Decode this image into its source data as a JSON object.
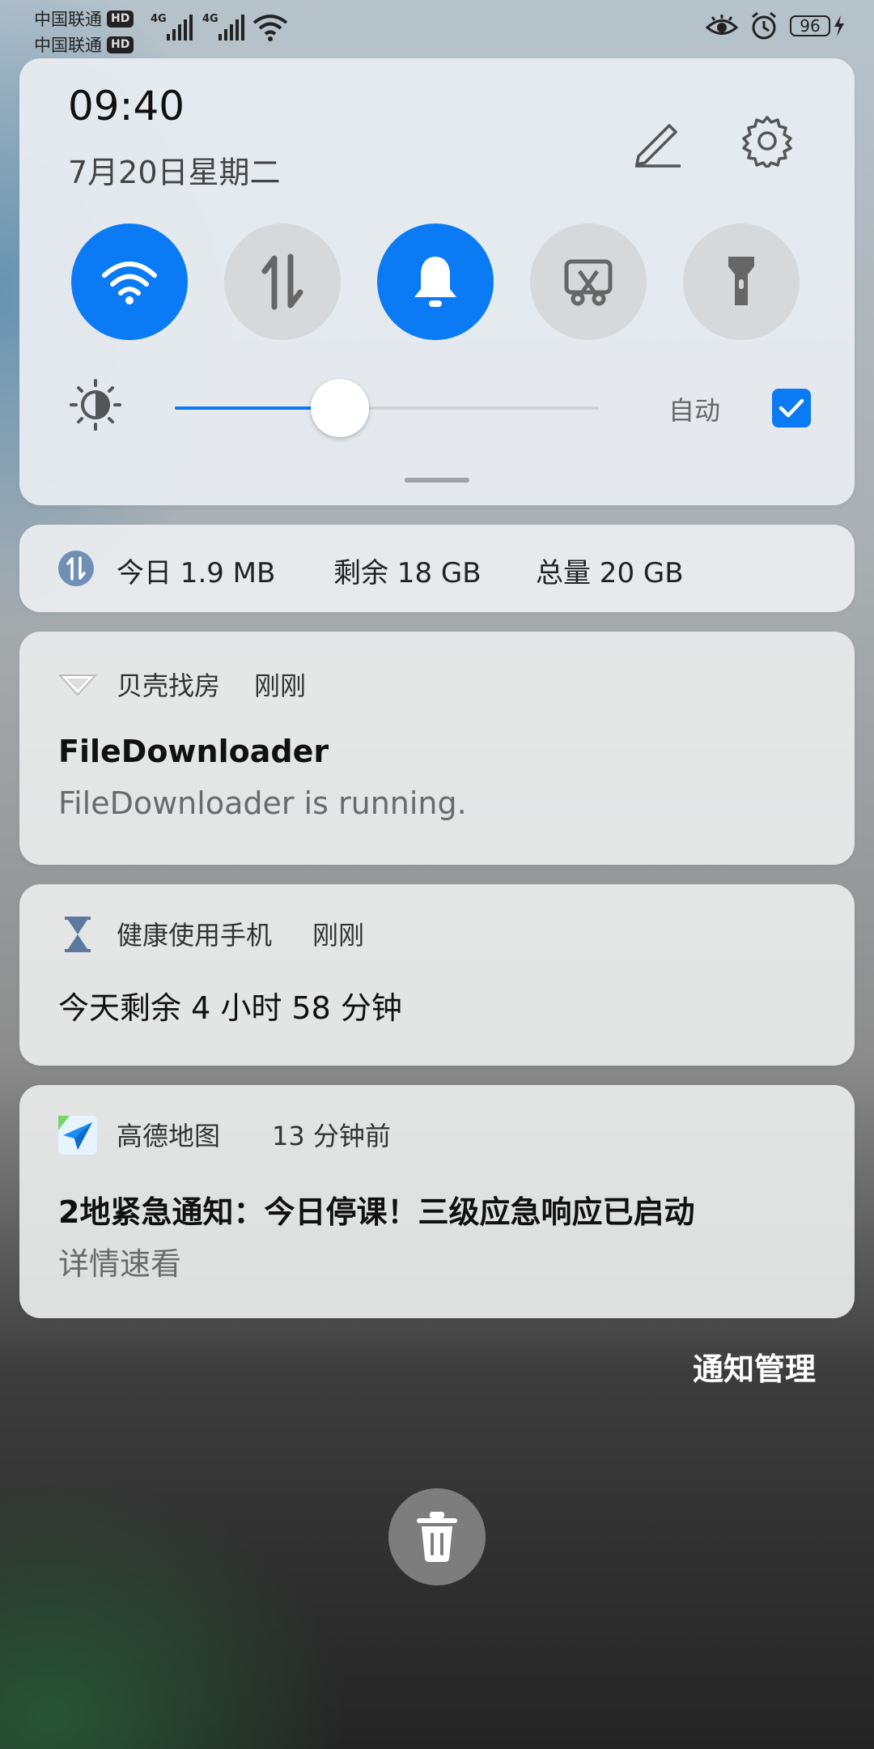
{
  "status_bar": {
    "carrier1": "中国联通",
    "carrier2": "中国联通",
    "hd": "HD",
    "net1": "4G",
    "net2": "4G",
    "battery": "96"
  },
  "quick_settings": {
    "time": "09:40",
    "date": "7月20日星期二",
    "tiles": [
      {
        "icon": "wifi-icon",
        "state": "on"
      },
      {
        "icon": "mobile-data-icon",
        "state": "off"
      },
      {
        "icon": "bell-icon",
        "state": "on"
      },
      {
        "icon": "screenshot-icon",
        "state": "off"
      },
      {
        "icon": "flashlight-icon",
        "state": "off"
      }
    ],
    "brightness_level": 0.39,
    "auto_label": "自动",
    "auto_checked": true,
    "accent_color": "#0a7bf5"
  },
  "data_usage": {
    "today": "今日 1.9 MB",
    "remaining": "剩余 18 GB",
    "total": "总量 20 GB"
  },
  "notifications": [
    {
      "app": "贝壳找房",
      "time": "刚刚",
      "title": "FileDownloader",
      "body": "FileDownloader is running."
    },
    {
      "app": "健康使用手机",
      "time": "刚刚",
      "title": "今天剩余 4 小时 58 分钟",
      "body": ""
    },
    {
      "app": "高德地图",
      "time": "13 分钟前",
      "title": "2地紧急通知：今日停课！三级应急响应已启动",
      "body": "详情速看"
    }
  ],
  "manage_label": "通知管理"
}
